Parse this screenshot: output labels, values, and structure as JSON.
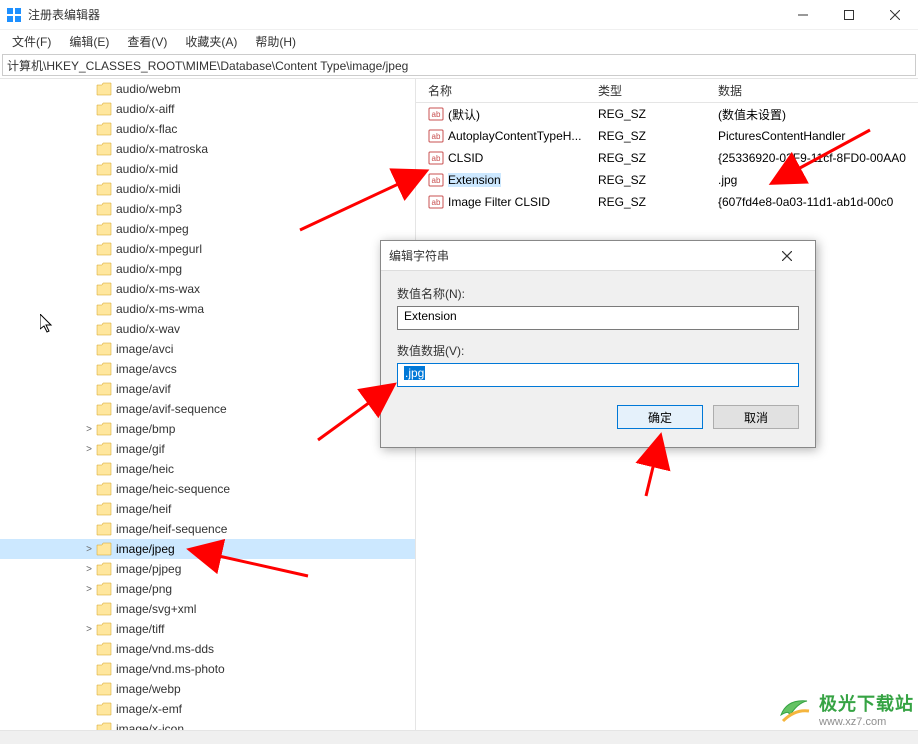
{
  "window": {
    "title": "注册表编辑器",
    "controls": {
      "min": "—",
      "max": "☐",
      "close": "✕"
    }
  },
  "menu": [
    {
      "label": "文件(F)"
    },
    {
      "label": "编辑(E)"
    },
    {
      "label": "查看(V)"
    },
    {
      "label": "收藏夹(A)"
    },
    {
      "label": "帮助(H)"
    }
  ],
  "address": "计算机\\HKEY_CLASSES_ROOT\\MIME\\Database\\Content Type\\image/jpeg",
  "tree": [
    {
      "label": "audio/webm",
      "expander": ""
    },
    {
      "label": "audio/x-aiff",
      "expander": ""
    },
    {
      "label": "audio/x-flac",
      "expander": ""
    },
    {
      "label": "audio/x-matroska",
      "expander": ""
    },
    {
      "label": "audio/x-mid",
      "expander": ""
    },
    {
      "label": "audio/x-midi",
      "expander": ""
    },
    {
      "label": "audio/x-mp3",
      "expander": ""
    },
    {
      "label": "audio/x-mpeg",
      "expander": ""
    },
    {
      "label": "audio/x-mpegurl",
      "expander": ""
    },
    {
      "label": "audio/x-mpg",
      "expander": ""
    },
    {
      "label": "audio/x-ms-wax",
      "expander": ""
    },
    {
      "label": "audio/x-ms-wma",
      "expander": ""
    },
    {
      "label": "audio/x-wav",
      "expander": ""
    },
    {
      "label": "image/avci",
      "expander": ""
    },
    {
      "label": "image/avcs",
      "expander": ""
    },
    {
      "label": "image/avif",
      "expander": ""
    },
    {
      "label": "image/avif-sequence",
      "expander": ""
    },
    {
      "label": "image/bmp",
      "expander": ">"
    },
    {
      "label": "image/gif",
      "expander": ">"
    },
    {
      "label": "image/heic",
      "expander": ""
    },
    {
      "label": "image/heic-sequence",
      "expander": ""
    },
    {
      "label": "image/heif",
      "expander": ""
    },
    {
      "label": "image/heif-sequence",
      "expander": ""
    },
    {
      "label": "image/jpeg",
      "expander": ">",
      "selected": true
    },
    {
      "label": "image/pjpeg",
      "expander": ">"
    },
    {
      "label": "image/png",
      "expander": ">"
    },
    {
      "label": "image/svg+xml",
      "expander": ""
    },
    {
      "label": "image/tiff",
      "expander": ">"
    },
    {
      "label": "image/vnd.ms-dds",
      "expander": ""
    },
    {
      "label": "image/vnd.ms-photo",
      "expander": ""
    },
    {
      "label": "image/webp",
      "expander": ""
    },
    {
      "label": "image/x-emf",
      "expander": ""
    },
    {
      "label": "image/x-icon",
      "expander": ""
    }
  ],
  "list": {
    "headers": {
      "name": "名称",
      "type": "类型",
      "data": "数据"
    },
    "rows": [
      {
        "name": "(默认)",
        "type": "REG_SZ",
        "data": "(数值未设置)",
        "icon": "str"
      },
      {
        "name": "AutoplayContentTypeH...",
        "type": "REG_SZ",
        "data": "PicturesContentHandler",
        "icon": "str"
      },
      {
        "name": "CLSID",
        "type": "REG_SZ",
        "data": "{25336920-03F9-11cf-8FD0-00AA0",
        "icon": "str"
      },
      {
        "name": "Extension",
        "type": "REG_SZ",
        "data": ".jpg",
        "icon": "str",
        "selected": true
      },
      {
        "name": "Image Filter CLSID",
        "type": "REG_SZ",
        "data": "{607fd4e8-0a03-11d1-ab1d-00c0",
        "icon": "str"
      }
    ]
  },
  "dialog": {
    "title": "编辑字符串",
    "name_label": "数值名称(N):",
    "name_value": "Extension",
    "data_label": "数值数据(V):",
    "data_value": ".jpg",
    "ok": "确定",
    "cancel": "取消"
  },
  "watermark": {
    "brand": "极光下载站",
    "url": "www.xz7.com"
  }
}
